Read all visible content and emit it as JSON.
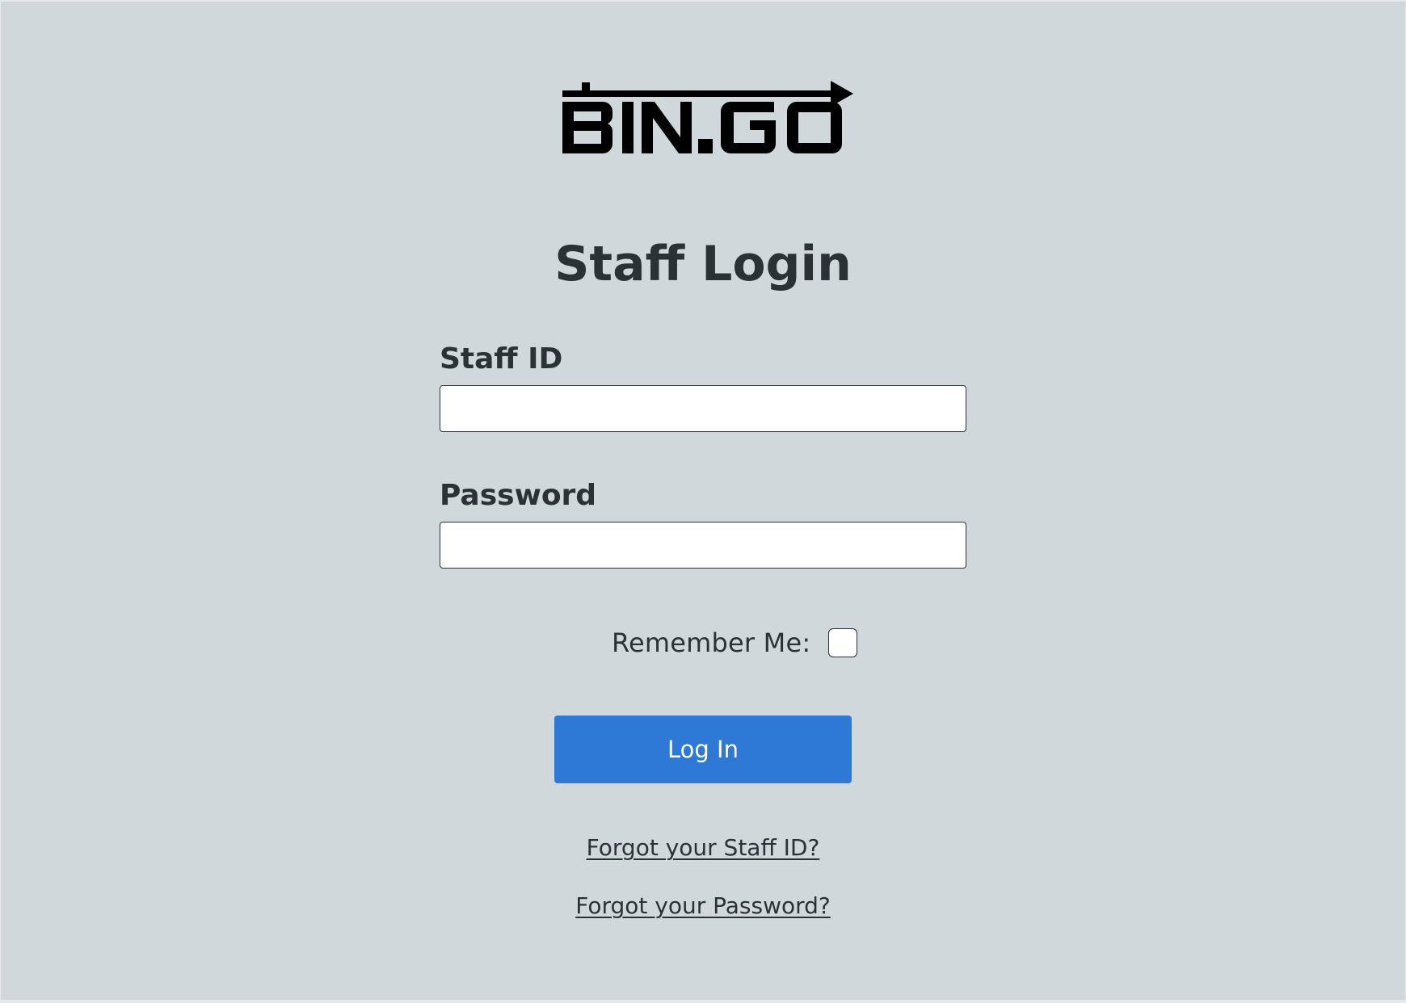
{
  "brand": {
    "logo_text": "BIN.GO"
  },
  "page": {
    "title": "Staff Login"
  },
  "form": {
    "staff_id": {
      "label": "Staff ID",
      "value": "",
      "placeholder": ""
    },
    "password": {
      "label": "Password",
      "value": "",
      "placeholder": ""
    },
    "remember_me": {
      "label": "Remember Me:",
      "checked": false
    },
    "login_button": "Log In"
  },
  "links": {
    "forgot_staff_id": "Forgot your Staff ID?",
    "forgot_password": "Forgot your Password?"
  },
  "colors": {
    "background": "#d1d8dc",
    "text": "#2b3236",
    "button": "#2e78d6",
    "button_text": "#ffffff"
  }
}
